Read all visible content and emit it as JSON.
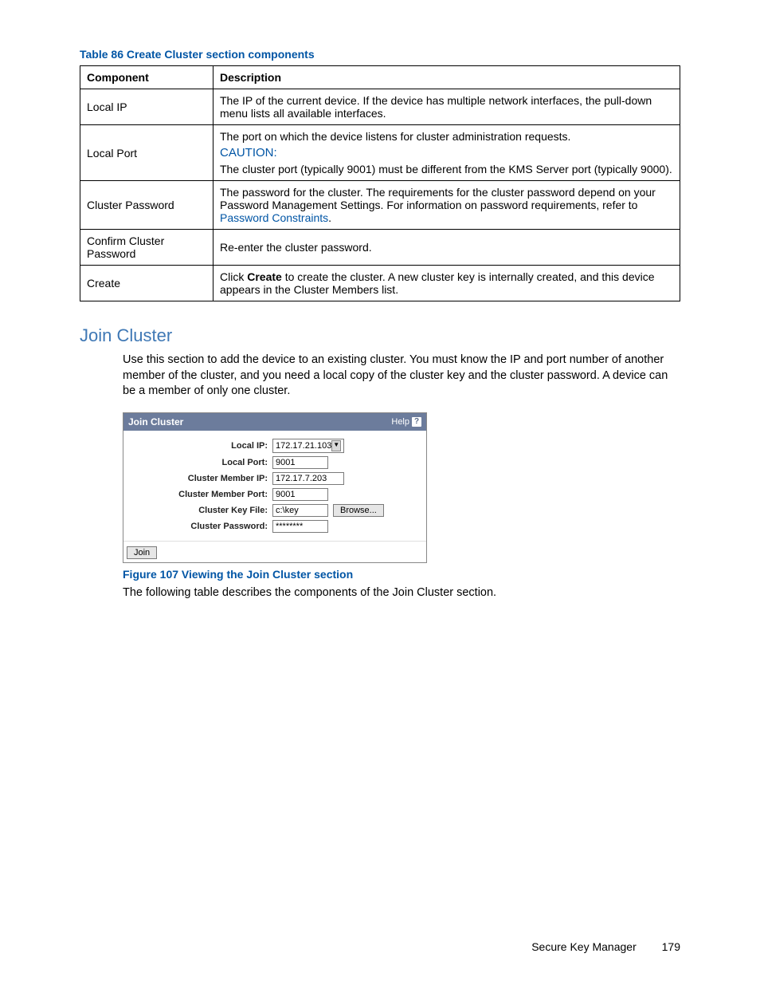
{
  "table86": {
    "caption": "Table 86 Create Cluster section components",
    "headers": {
      "c1": "Component",
      "c2": "Description"
    },
    "rows": {
      "localIp": {
        "c1": "Local IP",
        "c2": "The IP of the current device. If the device has multiple network interfaces, the pull-down menu lists all available interfaces."
      },
      "localPort": {
        "c1": "Local Port",
        "line1": "The port on which the device listens for cluster administration requests.",
        "caution": "CAUTION:",
        "line2": "The cluster port (typically 9001) must be different from the KMS Server port (typically 9000)."
      },
      "clusterPassword": {
        "c1": "Cluster Password",
        "pre": "The password for the cluster. The requirements for the cluster password depend on your Password Management Settings. For information on password requirements, refer to ",
        "link": "Password Constraints",
        "post": "."
      },
      "confirm": {
        "c1": "Confirm Cluster Password",
        "c2": "Re-enter the cluster password."
      },
      "create": {
        "c1": "Create",
        "pre": "Click ",
        "bold": "Create",
        "post": " to create the cluster. A new cluster key is internally created, and this device appears in the Cluster Members list."
      }
    }
  },
  "joinCluster": {
    "heading": "Join Cluster",
    "intro": "Use this section to add the device to an existing cluster. You must know the IP and port number of another member of the cluster, and you need a local copy of the cluster key and the cluster password. A device can be a member of only one cluster.",
    "panel": {
      "title": "Join Cluster",
      "help": "Help",
      "labels": {
        "localIp": "Local IP:",
        "localPort": "Local Port:",
        "memberIp": "Cluster Member IP:",
        "memberPort": "Cluster Member Port:",
        "keyFile": "Cluster Key File:",
        "password": "Cluster Password:"
      },
      "values": {
        "localIp": "172.17.21.103",
        "localPort": "9001",
        "memberIp": "172.17.7.203",
        "memberPort": "9001",
        "keyFile": "c:\\key",
        "password": "********"
      },
      "browseBtn": "Browse...",
      "joinBtn": "Join"
    },
    "figureCaption": "Figure 107 Viewing the Join Cluster section",
    "followupText": "The following table describes the components of the Join Cluster section."
  },
  "footer": {
    "product": "Secure Key Manager",
    "page": "179"
  }
}
